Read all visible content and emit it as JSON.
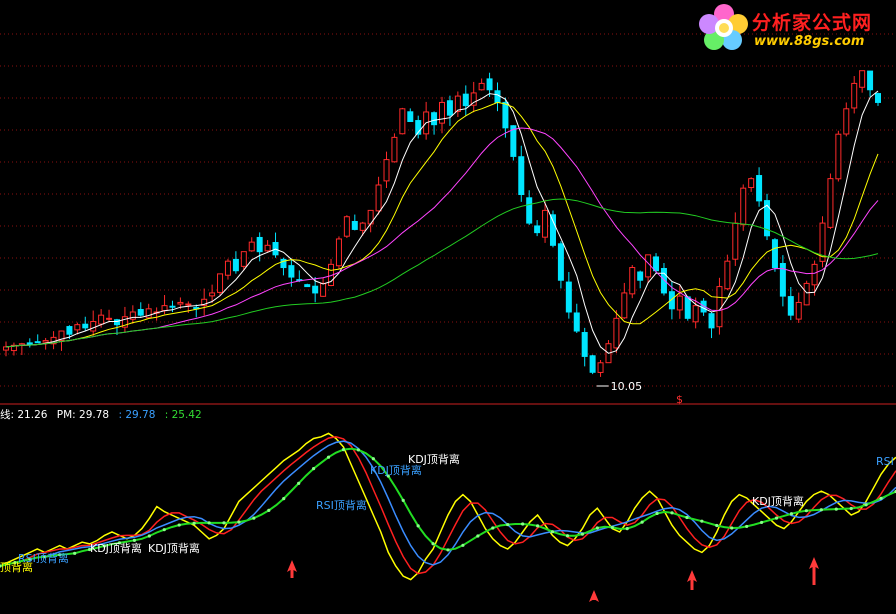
{
  "logo": {
    "title": "分析家公式网",
    "url": "www.88gs.com"
  },
  "price_panel": {
    "low_label": "10.05",
    "marker": "$"
  },
  "legend": {
    "a": "线: 21.26",
    "b": "PM: 29.78",
    "c": ": 29.78",
    "d": ": 25.42"
  },
  "annotations": [
    {
      "text": "KDJ顶背离",
      "color": "#ffffff",
      "size": 11
    },
    {
      "text": "KDJ顶背离",
      "color": "#3aa0ff",
      "size": 11
    },
    {
      "text": "RSI顶背离",
      "color": "#3aa0ff",
      "size": 11
    },
    {
      "text": "KDJ顶背离",
      "color": "#ffffff",
      "size": 11
    },
    {
      "text": "KDJ顶背离",
      "color": "#ffffff",
      "size": 11
    },
    {
      "text": "RSI顶背离",
      "color": "#3aa0ff",
      "size": 11
    },
    {
      "text": "KDJ顶背离",
      "color": "#ffffff",
      "size": 11
    },
    {
      "text": "RSI",
      "color": "#3aa0ff",
      "size": 11
    },
    {
      "text": "顶背离",
      "color": "#ffff00",
      "size": 11
    }
  ],
  "colors": {
    "up": "#ff2a2a",
    "down": "#00e5ff",
    "ma5": "#ffffff",
    "ma10": "#ffff00",
    "ma20": "#ff44ff",
    "ma60": "#22cc22"
  },
  "chart_data": {
    "type": "line",
    "candles_close": [
      10.9,
      10.95,
      11.0,
      10.98,
      11.05,
      11.1,
      11.2,
      11.4,
      11.3,
      11.6,
      11.5,
      11.7,
      11.9,
      11.8,
      11.6,
      11.85,
      12.0,
      11.9,
      12.1,
      12.0,
      12.2,
      12.15,
      12.3,
      12.25,
      12.1,
      12.4,
      12.6,
      13.2,
      13.6,
      13.3,
      13.9,
      14.2,
      13.9,
      14.1,
      13.8,
      13.4,
      13.1,
      13.0,
      12.8,
      12.6,
      12.9,
      13.5,
      14.3,
      15.0,
      14.6,
      14.8,
      15.2,
      16.0,
      16.8,
      17.5,
      18.4,
      18.0,
      17.6,
      18.3,
      17.9,
      18.6,
      18.2,
      18.8,
      18.5,
      18.9,
      19.2,
      19.0,
      18.6,
      17.8,
      16.9,
      15.7,
      14.8,
      14.5,
      15.2,
      14.1,
      13.0,
      12.0,
      11.4,
      10.6,
      10.1,
      10.4,
      11.0,
      11.8,
      12.6,
      13.4,
      13.0,
      13.8,
      13.3,
      12.6,
      12.1,
      12.5,
      11.8,
      12.2,
      12.0,
      11.5,
      12.8,
      13.6,
      14.8,
      15.9,
      16.2,
      15.5,
      14.4,
      13.4,
      12.5,
      11.9,
      12.3,
      12.9,
      13.5,
      14.8,
      16.2,
      17.6,
      18.4,
      19.2,
      19.6,
      19.0,
      18.6
    ]
  }
}
